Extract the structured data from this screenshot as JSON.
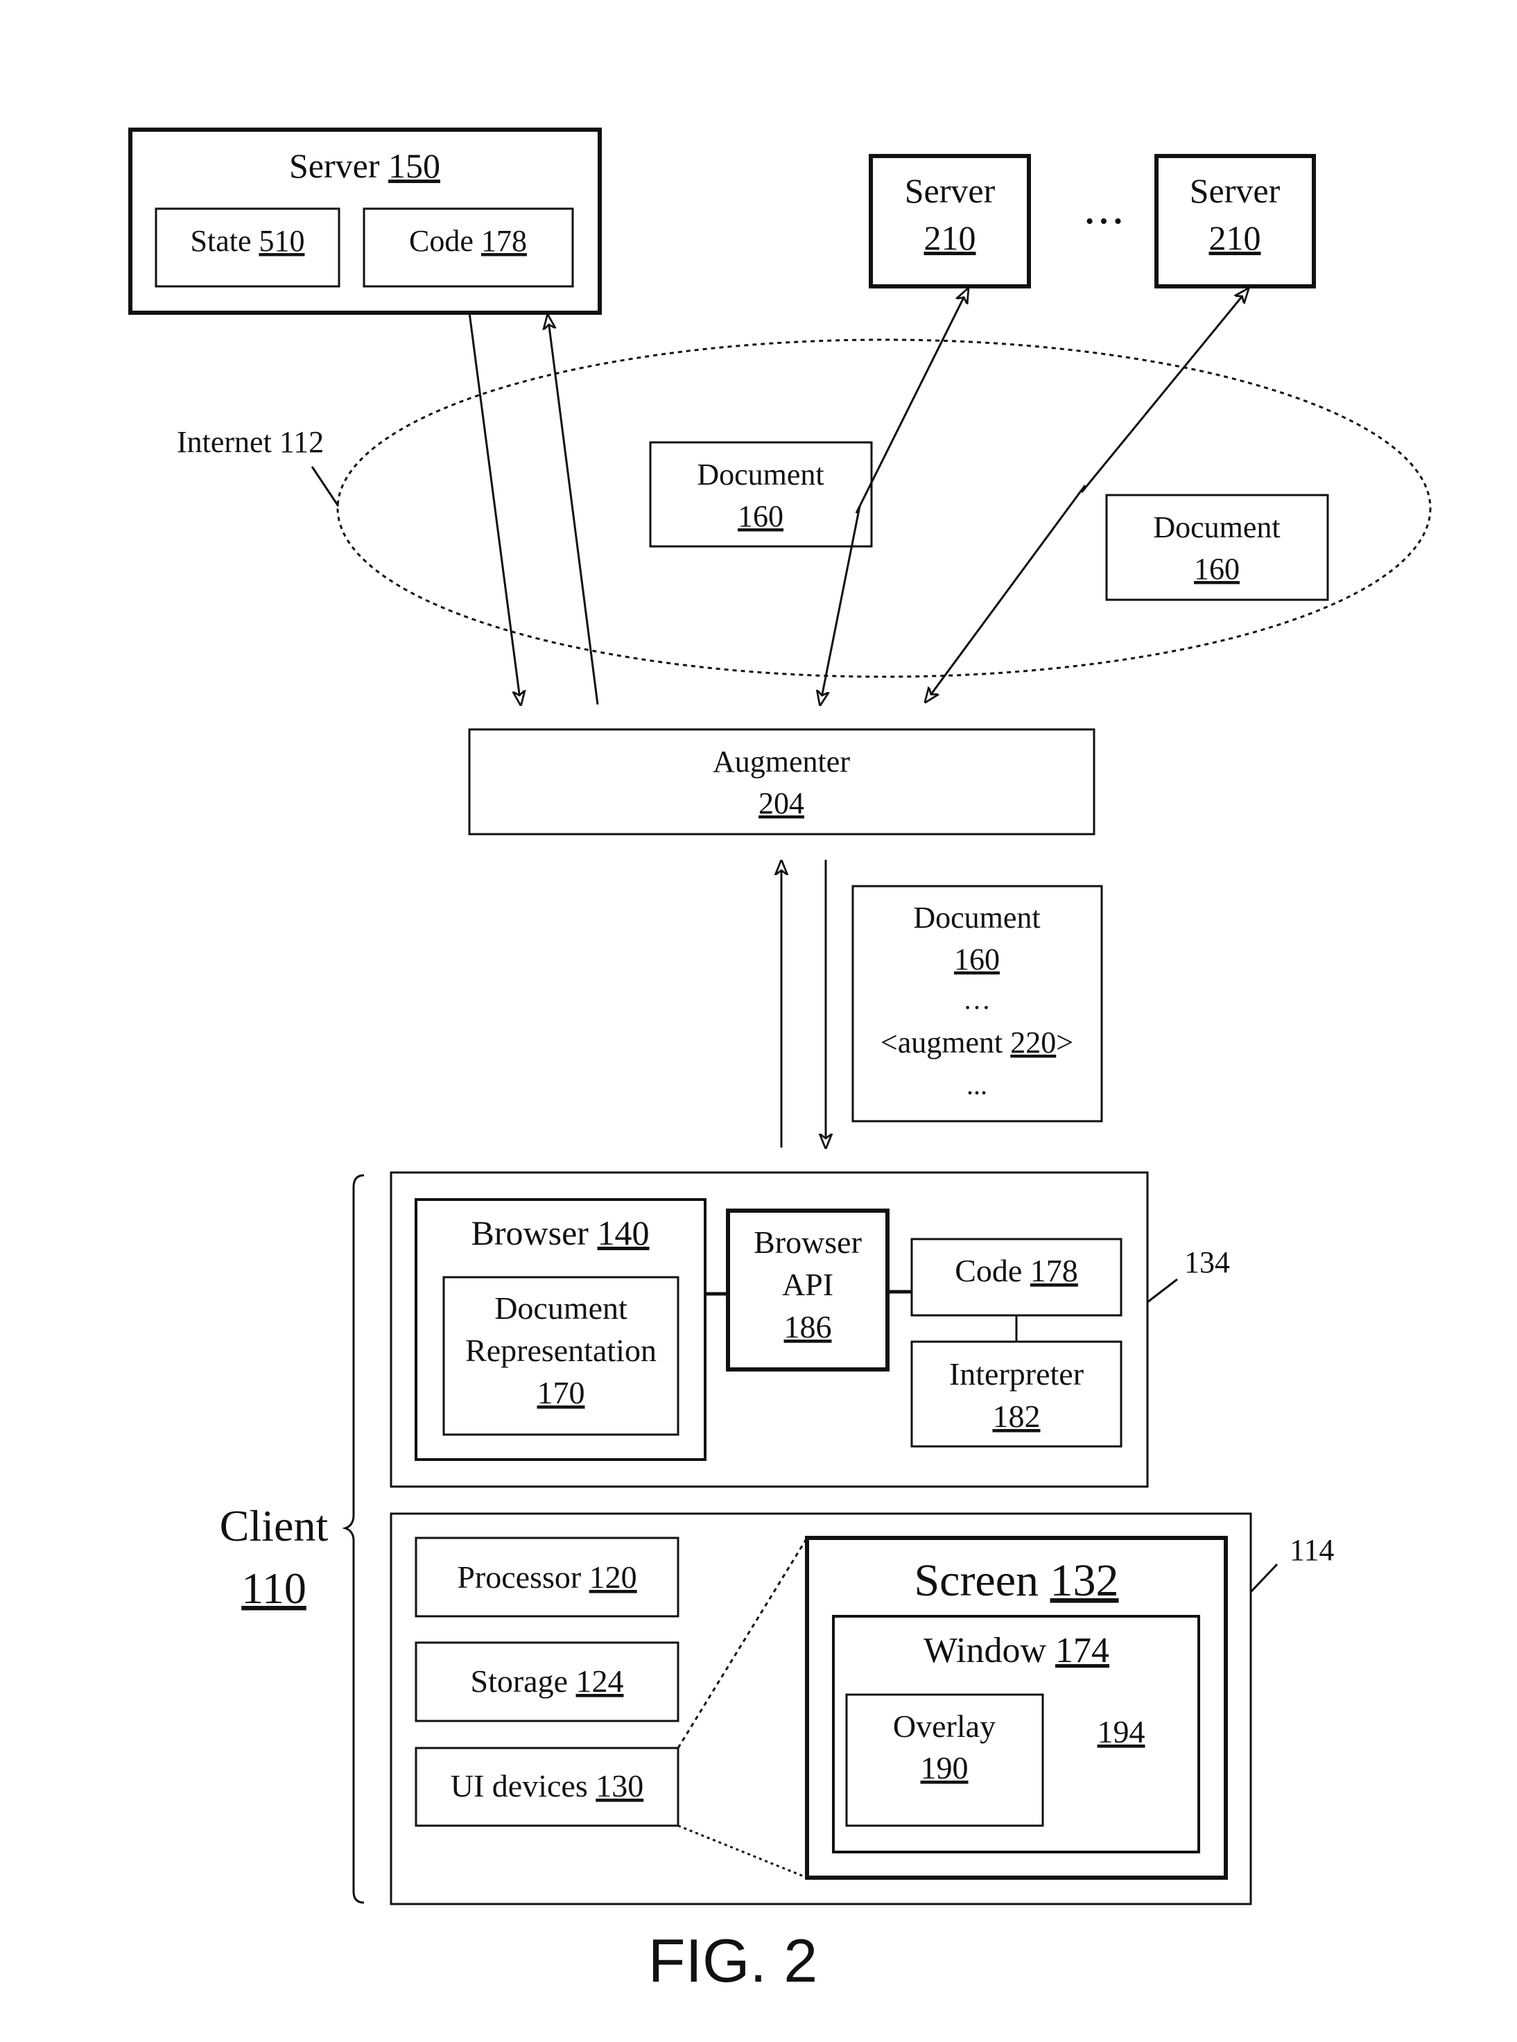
{
  "figure": {
    "caption": "FIG. 2"
  },
  "server150": {
    "title": "Server ",
    "ref": "150",
    "state": {
      "title": "State ",
      "ref": "510"
    },
    "code": {
      "title": "Code ",
      "ref": "178"
    }
  },
  "servers210": [
    {
      "title": "Server",
      "ref": "210"
    },
    {
      "title": "Server",
      "ref": "210"
    }
  ],
  "servers_ellipsis": "• • •",
  "internet": {
    "label": "Internet 112"
  },
  "internet_documents": [
    {
      "title": "Document",
      "ref": "160"
    },
    {
      "title": "Document",
      "ref": "160"
    }
  ],
  "augmenter": {
    "title": "Augmenter",
    "ref": "204"
  },
  "augmented_document": {
    "title": "Document",
    "ref": "160",
    "ellipsis_top": "…",
    "augment_prefix": "<augment ",
    "augment_ref": "220",
    "augment_suffix": ">",
    "ellipsis_bottom": "..."
  },
  "software_block": {
    "ref_label": "134",
    "browser": {
      "title": "Browser ",
      "ref": "140"
    },
    "doc_representation": {
      "line1": "Document",
      "line2": "Representation",
      "ref": "170"
    },
    "browser_api": {
      "line1": "Browser",
      "line2": "API",
      "ref": "186"
    },
    "code": {
      "title": "Code ",
      "ref": "178"
    },
    "interpreter": {
      "title": "Interpreter",
      "ref": "182"
    }
  },
  "hardware_block": {
    "ref_label": "114",
    "processor": {
      "title": "Processor ",
      "ref": "120"
    },
    "storage": {
      "title": "Storage ",
      "ref": "124"
    },
    "ui_devices": {
      "title": "UI devices ",
      "ref": "130"
    },
    "screen": {
      "title": "Screen ",
      "ref": "132"
    },
    "window": {
      "title": "Window ",
      "ref": "174"
    },
    "overlay": {
      "title": "Overlay",
      "ref": "190"
    },
    "region_ref": "194"
  },
  "client": {
    "title": "Client",
    "ref": "110"
  }
}
